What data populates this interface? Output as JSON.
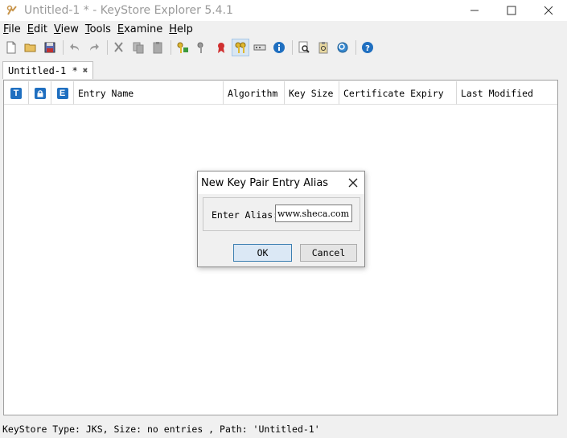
{
  "window": {
    "title": "Untitled-1 * - KeyStore Explorer 5.4.1",
    "controls": [
      "minimize-icon",
      "maximize-icon",
      "close-icon"
    ]
  },
  "menu": {
    "items": [
      {
        "mnemonic": "F",
        "rest": "ile"
      },
      {
        "mnemonic": "E",
        "rest": "dit"
      },
      {
        "mnemonic": "V",
        "rest": "iew"
      },
      {
        "mnemonic": "T",
        "rest": "ools"
      },
      {
        "mnemonic": "E",
        "rest": "xamine"
      },
      {
        "mnemonic": "H",
        "rest": "elp"
      }
    ]
  },
  "toolbar": {
    "icons": [
      "new-icon",
      "open-icon",
      "save-icon",
      "undo-icon",
      "redo-icon",
      "cut-icon",
      "copy-icon",
      "paste-icon",
      "generate-key-pair-icon",
      "generate-secret-key-icon",
      "import-trusted-cert-icon",
      "import-key-pair-icon",
      "set-password-icon",
      "properties-icon",
      "examine-file-icon",
      "examine-clipboard-icon",
      "examine-ssl-icon",
      "help-icon"
    ]
  },
  "tabs": [
    {
      "label": "Untitled-1 *"
    }
  ],
  "table": {
    "columns": {
      "type_icon": "T",
      "lock_icon": "lock-icon",
      "expiry_icon": "E",
      "entry_name": "Entry Name",
      "algorithm": "Algorithm",
      "key_size": "Key Size",
      "cert_expiry": "Certificate Expiry",
      "last_modified": "Last Modified"
    },
    "rows": []
  },
  "status": {
    "text": "KeyStore Type: JKS, Size: no entries , Path: 'Untitled-1'"
  },
  "dialog": {
    "title": "New Key Pair Entry Alias",
    "label": "Enter Alias:",
    "alias_value": "www.sheca.com",
    "ok_label": "OK",
    "cancel_label": "Cancel"
  },
  "colors": {
    "accent": "#1f6fc0",
    "ok_border": "#3c7fb1"
  }
}
